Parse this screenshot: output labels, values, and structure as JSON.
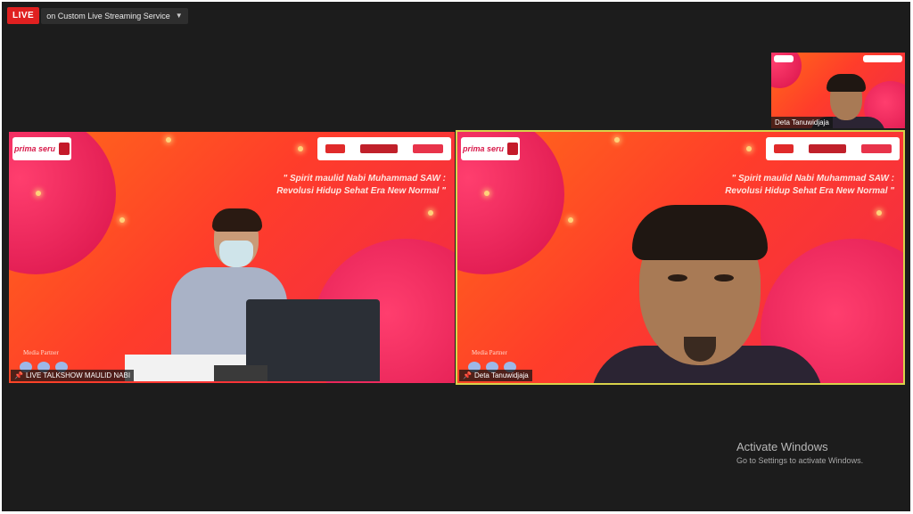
{
  "topbar": {
    "live_label": "LIVE",
    "stream_label": "on Custom Live Streaming Service"
  },
  "tiles": [
    {
      "name_tag": "LIVE TALKSHOW MAULID NABI",
      "logo_text": "prima seru",
      "slogan_line1": "\" Spirit maulid Nabi Muhammad SAW :",
      "slogan_line2": "Revolusi Hidup Sehat Era New Normal \"",
      "media_partner": "Media Partner"
    },
    {
      "name_tag": "Deta Tanuwidjaja",
      "logo_text": "prima seru",
      "slogan_line1": "\" Spirit maulid Nabi Muhammad SAW :",
      "slogan_line2": "Revolusi Hidup Sehat Era New Normal \"",
      "media_partner": "Media Partner"
    }
  ],
  "thumbnail": {
    "name_tag": "Deta Tanuwidjaja"
  },
  "watermark": {
    "title": "Activate Windows",
    "subtitle": "Go to Settings to activate Windows."
  },
  "colors": {
    "live_red": "#e02020",
    "active_outline": "#d8d24a",
    "background": "#1c1c1c"
  }
}
